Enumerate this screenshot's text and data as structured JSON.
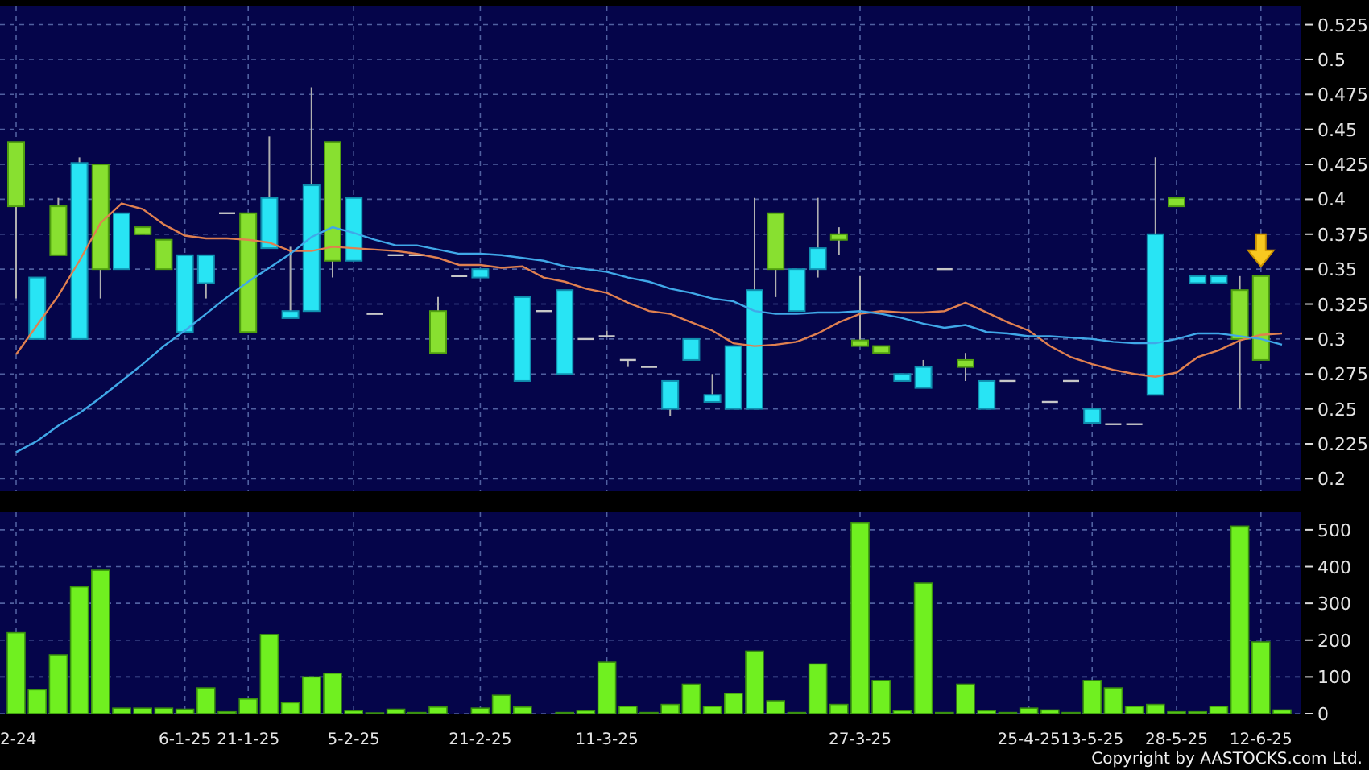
{
  "price_chart": {
    "chart_data": {
      "type": "candlestick",
      "grid": true,
      "ylim": [
        0.191,
        0.538
      ],
      "yticks": [
        0.525,
        0.5,
        0.475,
        0.45,
        0.425,
        0.4,
        0.375,
        0.35,
        0.325,
        0.3,
        0.275,
        0.25,
        0.225,
        0.2
      ],
      "series": [
        {
          "type": "line",
          "color": "#e08050",
          "values": [
            0.289,
            0.31,
            0.331,
            0.356,
            0.383,
            0.397,
            0.393,
            0.382,
            0.374,
            0.372,
            0.372,
            0.371,
            0.369,
            0.363,
            0.363,
            0.366,
            0.365,
            0.364,
            0.363,
            0.361,
            0.358,
            0.353,
            0.353,
            0.351,
            0.352,
            0.344,
            0.341,
            0.336,
            0.333,
            0.326,
            0.32,
            0.318,
            0.312,
            0.306,
            0.297,
            0.295,
            0.296,
            0.298,
            0.304,
            0.312,
            0.318,
            0.32,
            0.319,
            0.319,
            0.32,
            0.326,
            0.319,
            0.312,
            0.306,
            0.295,
            0.287,
            0.282,
            0.278,
            0.275,
            0.273,
            0.276,
            0.287,
            0.292,
            0.299,
            0.303,
            0.304
          ]
        },
        {
          "type": "line",
          "color": "#40a8e8",
          "values": [
            0.219,
            0.227,
            0.238,
            0.247,
            0.258,
            0.27,
            0.282,
            0.295,
            0.306,
            0.318,
            0.33,
            0.341,
            0.351,
            0.361,
            0.373,
            0.38,
            0.376,
            0.371,
            0.367,
            0.367,
            0.364,
            0.361,
            0.361,
            0.36,
            0.358,
            0.356,
            0.352,
            0.35,
            0.348,
            0.344,
            0.341,
            0.336,
            0.333,
            0.329,
            0.327,
            0.32,
            0.318,
            0.318,
            0.319,
            0.319,
            0.32,
            0.318,
            0.315,
            0.311,
            0.308,
            0.31,
            0.305,
            0.304,
            0.302,
            0.302,
            0.301,
            0.3,
            0.298,
            0.297,
            0.297,
            0.3,
            0.304,
            0.304,
            0.302,
            0.3,
            0.296
          ]
        }
      ],
      "ohlc": [
        [
          0.395,
          0.441,
          0.329,
          0.441
        ],
        [
          0.344,
          0.344,
          0.3,
          0.3
        ],
        [
          0.36,
          0.401,
          0.36,
          0.395
        ],
        [
          0.426,
          0.43,
          0.3,
          0.3
        ],
        [
          0.35,
          0.425,
          0.329,
          0.425
        ],
        [
          0.39,
          0.39,
          0.35,
          0.35
        ],
        [
          0.375,
          0.38,
          0.375,
          0.38
        ],
        [
          0.35,
          0.371,
          0.35,
          0.371
        ],
        [
          0.36,
          0.36,
          0.305,
          0.305
        ],
        [
          0.36,
          0.36,
          0.329,
          0.34
        ],
        [
          0.39,
          0.39,
          0.39,
          0.39
        ],
        [
          0.305,
          0.39,
          0.305,
          0.39
        ],
        [
          0.401,
          0.445,
          0.365,
          0.365
        ],
        [
          0.32,
          0.366,
          0.315,
          0.315
        ],
        [
          0.41,
          0.48,
          0.32,
          0.32
        ],
        [
          0.356,
          0.441,
          0.344,
          0.441
        ],
        [
          0.401,
          0.401,
          0.356,
          0.356
        ],
        [
          0.318,
          0.318,
          0.318,
          0.318
        ],
        [
          0.36,
          0.36,
          0.36,
          0.36
        ],
        [
          0.36,
          0.36,
          0.36,
          0.36
        ],
        [
          0.29,
          0.33,
          0.29,
          0.32
        ],
        [
          0.345,
          0.345,
          0.345,
          0.345
        ],
        [
          0.35,
          0.35,
          0.344,
          0.344
        ],
        null,
        [
          0.33,
          0.33,
          0.27,
          0.27
        ],
        [
          0.32,
          0.32,
          0.32,
          0.32
        ],
        [
          0.335,
          0.335,
          0.275,
          0.275
        ],
        [
          0.3,
          0.3,
          0.3,
          0.3
        ],
        [
          0.302,
          0.306,
          0.302,
          0.302
        ],
        [
          0.285,
          0.285,
          0.28,
          0.285
        ],
        [
          0.28,
          0.28,
          0.28,
          0.28
        ],
        [
          0.27,
          0.27,
          0.245,
          0.25
        ],
        [
          0.3,
          0.3,
          0.285,
          0.285
        ],
        [
          0.26,
          0.275,
          0.255,
          0.255
        ],
        [
          0.295,
          0.295,
          0.25,
          0.25
        ],
        [
          0.335,
          0.401,
          0.25,
          0.25
        ],
        [
          0.35,
          0.39,
          0.33,
          0.39
        ],
        [
          0.35,
          0.35,
          0.32,
          0.32
        ],
        [
          0.365,
          0.401,
          0.344,
          0.35
        ],
        [
          0.371,
          0.38,
          0.36,
          0.375
        ],
        [
          0.295,
          0.345,
          0.295,
          0.299
        ],
        [
          0.29,
          0.295,
          0.29,
          0.295
        ],
        [
          0.275,
          0.275,
          0.27,
          0.27
        ],
        [
          0.28,
          0.285,
          0.265,
          0.265
        ],
        [
          0.35,
          0.35,
          0.35,
          0.35
        ],
        [
          0.28,
          0.29,
          0.27,
          0.285
        ],
        [
          0.27,
          0.27,
          0.25,
          0.25
        ],
        [
          0.27,
          0.27,
          0.27,
          0.27
        ],
        null,
        [
          0.255,
          0.255,
          0.255,
          0.255
        ],
        [
          0.27,
          0.27,
          0.27,
          0.27
        ],
        [
          0.25,
          0.25,
          0.24,
          0.24
        ],
        [
          0.239,
          0.239,
          0.239,
          0.239
        ],
        [
          0.239,
          0.239,
          0.239,
          0.239
        ],
        [
          0.375,
          0.43,
          0.26,
          0.26
        ],
        [
          0.395,
          0.401,
          0.395,
          0.401
        ],
        [
          0.345,
          0.345,
          0.34,
          0.34
        ],
        [
          0.345,
          0.345,
          0.34,
          0.34
        ],
        [
          0.3,
          0.345,
          0.25,
          0.335
        ],
        [
          0.285,
          0.345,
          0.285,
          0.345
        ],
        null
      ]
    }
  },
  "volume_chart": {
    "chart_data": {
      "type": "bar",
      "grid": true,
      "ylim": [
        0,
        548
      ],
      "yticks": [
        0,
        100,
        200,
        300,
        400,
        500
      ],
      "categories": [
        "2-24",
        null,
        null,
        null,
        null,
        null,
        null,
        null,
        "6-1-25",
        null,
        null,
        "21-1-25",
        null,
        null,
        null,
        null,
        "5-2-25",
        null,
        null,
        null,
        null,
        null,
        "21-2-25",
        null,
        null,
        null,
        null,
        null,
        "11-3-25",
        null,
        null,
        null,
        null,
        null,
        null,
        null,
        null,
        null,
        null,
        null,
        "27-3-25",
        null,
        null,
        null,
        null,
        null,
        null,
        null,
        "25-4-25",
        null,
        null,
        "13-5-25",
        null,
        null,
        null,
        "28-5-25",
        null,
        null,
        null,
        "12-6-25",
        null
      ],
      "values": [
        220,
        65,
        160,
        345,
        390,
        15,
        15,
        15,
        12,
        70,
        5,
        40,
        215,
        30,
        100,
        110,
        8,
        2,
        12,
        3,
        18,
        0,
        15,
        50,
        18,
        0,
        3,
        8,
        140,
        20,
        3,
        25,
        80,
        20,
        55,
        170,
        35,
        3,
        135,
        25,
        520,
        90,
        8,
        355,
        3,
        80,
        8,
        3,
        15,
        10,
        3,
        90,
        70,
        20,
        25,
        5,
        5,
        20,
        510,
        195,
        10
      ]
    }
  },
  "copyright": "Copyright by AASTOCKS.com Ltd."
}
